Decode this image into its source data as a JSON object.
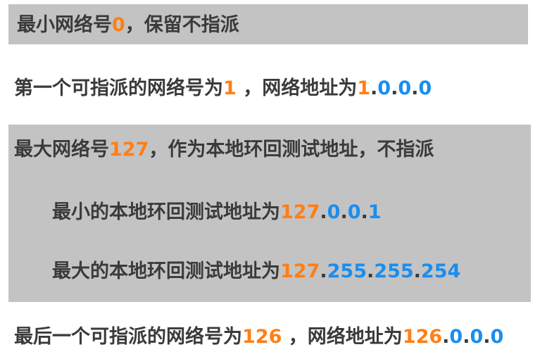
{
  "colors": {
    "band": "#c3c3c3",
    "text": "#3a3a3a",
    "orange": "#ff7f15",
    "blue": "#1a8df0"
  },
  "line1": {
    "text1": "最小网络号",
    "num": "0",
    "text2": "，保留不指派"
  },
  "line2": {
    "text1": "第一个可指派的网络号为",
    "num": "1",
    "text2": " ，网络地址为",
    "addr_net": "1",
    "addr_host": [
      ".",
      "0",
      ".",
      "0",
      ".",
      "0"
    ]
  },
  "line3": {
    "text1": "最大网络号",
    "num": "127",
    "text2": "，作为本地环回测试地址，不指派"
  },
  "line4": {
    "text1": "最小的本地环回测试地址为",
    "addr_net": "127",
    "addr_host": [
      ".",
      "0",
      ".",
      "0",
      ".",
      "1"
    ]
  },
  "line5": {
    "text1": "最大的本地环回测试地址为",
    "addr_net": "127",
    "addr_host": [
      ".",
      "255",
      ".",
      "255",
      ".",
      "254"
    ]
  },
  "line6": {
    "text1": "最后一个可指派的网络号为",
    "num": "126",
    "text2": " ，网络地址为",
    "addr_net": "126",
    "addr_host": [
      ".",
      "0",
      ".",
      "0",
      ".",
      "0"
    ]
  }
}
